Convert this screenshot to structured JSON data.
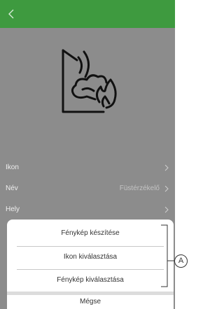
{
  "header": {
    "back_icon": "chevron-left-icon",
    "color": "#3e9a3f"
  },
  "device": {
    "icon": "smoke-detector-icon"
  },
  "settings": {
    "rows": [
      {
        "label": "Ikon",
        "value": ""
      },
      {
        "label": "Név",
        "value": "Füstérzékelő"
      },
      {
        "label": "Hely",
        "value": ""
      }
    ]
  },
  "action_sheet": {
    "options": [
      "Fénykép készítése",
      "Ikon kiválasztása",
      "Fénykép kiválasztása"
    ],
    "cancel_label": "Mégse"
  },
  "callout": {
    "label": "A"
  }
}
